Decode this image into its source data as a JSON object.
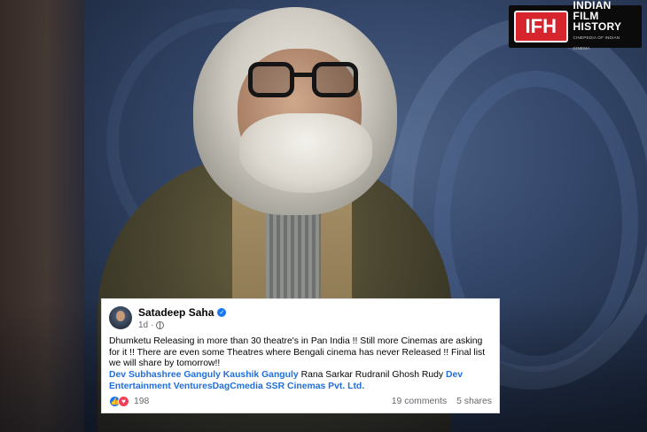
{
  "logo": {
    "badge": "IFH",
    "line1": "INDIAN",
    "line2": "FILM",
    "line3": "HISTORY",
    "tagline": "CINEPEDIA OF INDIAN CINEMA"
  },
  "post": {
    "author": "Satadeep Saha",
    "time": "1d",
    "text": "Dhumketu Releasing in more than 30 theatre's in Pan India !! Still more Cinemas are asking for it !! There are even some Theatres where Bengali cinema has never Released !! Final list we will share by tomorrow!!",
    "tag_1": "Dev",
    "tag_2": "Subhashree Ganguly",
    "tag_3": "Kaushik Ganguly",
    "tag_4": "Rana Sarkar Rudranil Ghosh Rudy",
    "tag_5": "Dev Entertainment Ventures",
    "tag_6": "DagCmedia",
    "tag_7": "SSR Cinemas Pvt. Ltd.",
    "reaction_count": "198",
    "comments": "19 comments",
    "shares": "5 shares"
  },
  "colors": {
    "link_blue": "#216fdb",
    "like_blue": "#1877f2",
    "love_red": "#f33e58",
    "logo_red": "#d6252d"
  }
}
